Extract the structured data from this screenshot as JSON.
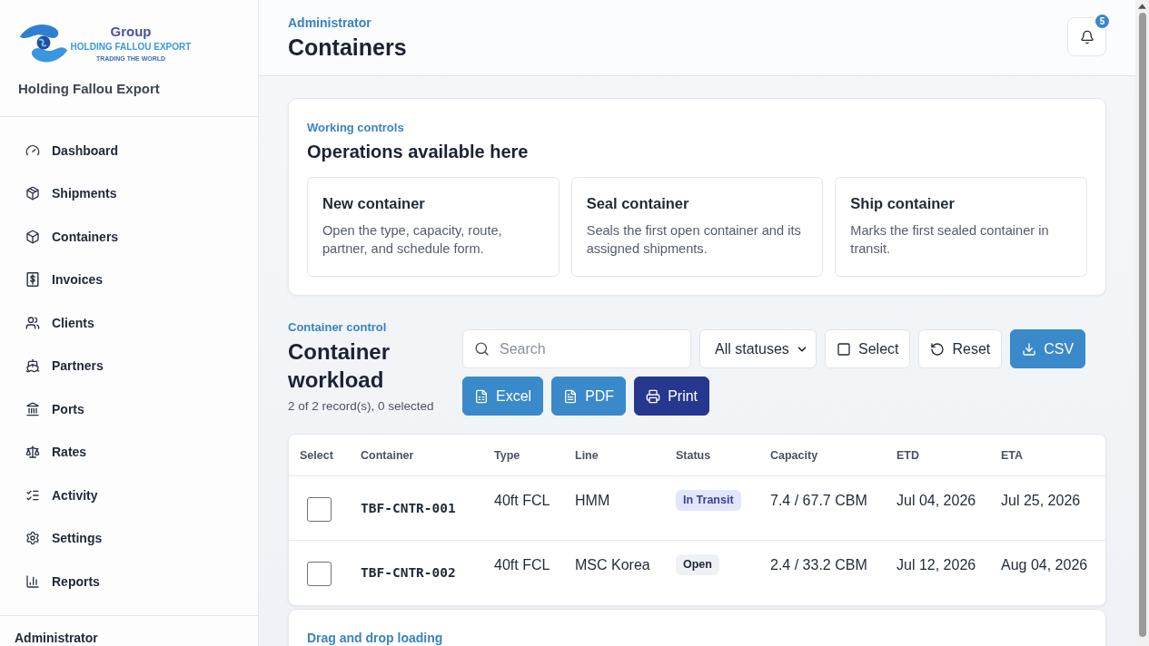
{
  "sidebar": {
    "logo": {
      "title": "Group",
      "name": "HOLDING FALLOU EXPORT",
      "tagline": "TRADING THE WORLD"
    },
    "company": "Holding Fallou Export",
    "nav_items": [
      {
        "label": "Dashboard"
      },
      {
        "label": "Shipments"
      },
      {
        "label": "Containers"
      },
      {
        "label": "Invoices"
      },
      {
        "label": "Clients"
      },
      {
        "label": "Partners"
      },
      {
        "label": "Ports"
      },
      {
        "label": "Rates"
      },
      {
        "label": "Activity"
      },
      {
        "label": "Settings"
      },
      {
        "label": "Reports"
      }
    ],
    "footer_user": "Administrator"
  },
  "header": {
    "eyebrow": "Administrator",
    "title": "Containers",
    "notifications": {
      "count": "5"
    }
  },
  "operations": {
    "eyebrow": "Working controls",
    "title": "Operations available here",
    "cards": [
      {
        "title": "New container",
        "description": "Open the type, capacity, route, partner, and schedule form."
      },
      {
        "title": "Seal container",
        "description": "Seals the first open container and its assigned shipments."
      },
      {
        "title": "Ship container",
        "description": "Marks the first sealed container in transit."
      }
    ]
  },
  "workload": {
    "eyebrow": "Container control",
    "title": "Container workload",
    "summary": "2 of 2 record(s), 0 selected",
    "search": {
      "placeholder": "Search"
    },
    "status_filter": "All statuses",
    "buttons": [
      {
        "label": "Select",
        "kind": "outline"
      },
      {
        "label": "Reset",
        "kind": "outline"
      },
      {
        "label": "CSV",
        "kind": "primary"
      },
      {
        "label": "Excel",
        "kind": "primary"
      },
      {
        "label": "PDF",
        "kind": "primary"
      },
      {
        "label": "Print",
        "kind": "dark"
      }
    ],
    "table": {
      "columns": [
        "Select",
        "Container",
        "Type",
        "Line",
        "Status",
        "Capacity",
        "ETD",
        "ETA"
      ],
      "rows": [
        {
          "checked": false,
          "container": "TBF-CNTR-001",
          "type": "40ft FCL",
          "line": "HMM",
          "status": {
            "label": "In Transit",
            "kind": "transit"
          },
          "capacity": "7.4 / 67.7 CBM",
          "etd": "Jul 04, 2026",
          "eta": "Jul 25, 2026"
        },
        {
          "checked": false,
          "container": "TBF-CNTR-002",
          "type": "40ft FCL",
          "line": "MSC Korea",
          "status": {
            "label": "Open",
            "kind": "open"
          },
          "capacity": "2.4 / 33.2 CBM",
          "etd": "Jul 12, 2026",
          "eta": "Aug 04, 2026"
        }
      ]
    }
  },
  "loading": {
    "eyebrow": "Drag and drop loading"
  }
}
